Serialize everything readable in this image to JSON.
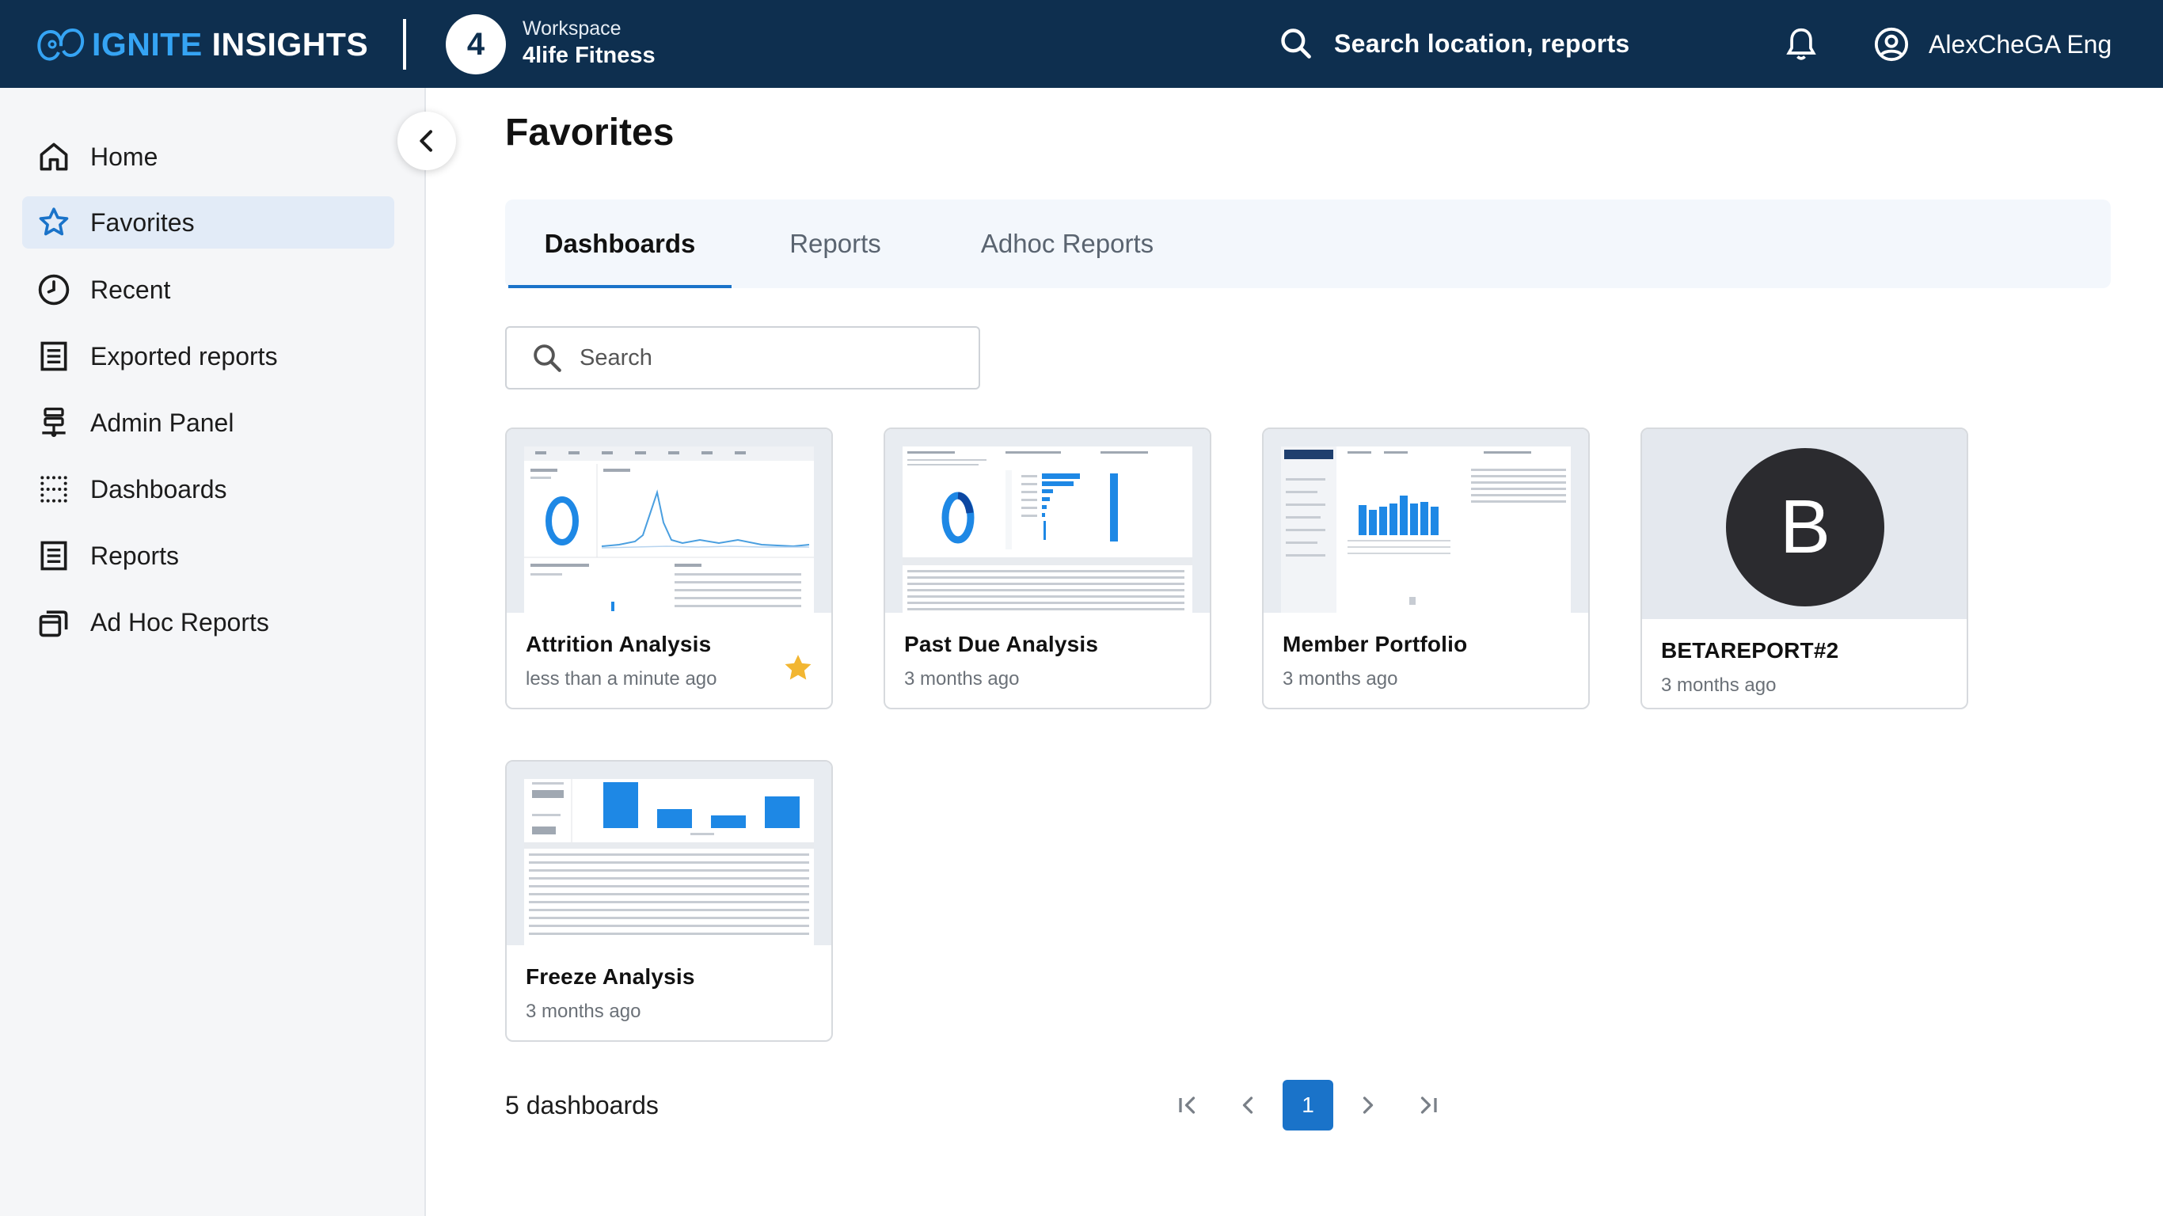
{
  "app": {
    "logo_part1": "IGNITE",
    "logo_part2": "INSIGHTS",
    "workspace_badge": "4",
    "workspace_label": "Workspace",
    "workspace_name": "4life Fitness",
    "search_label": "Search location, reports",
    "user_name": "AlexCheGA Eng",
    "colors": {
      "header_bg": "#0e2f4f",
      "logo_accent": "#35a4f4",
      "primary": "#1a73c9",
      "star": "#f2b632"
    }
  },
  "sidebar": {
    "items": [
      {
        "label": "Home",
        "icon": "home-icon",
        "active": false
      },
      {
        "label": "Favorites",
        "icon": "star-icon",
        "active": true
      },
      {
        "label": "Recent",
        "icon": "clock-icon",
        "active": false
      },
      {
        "label": "Exported reports",
        "icon": "document-list-icon",
        "active": false
      },
      {
        "label": "Admin Panel",
        "icon": "admin-network-icon",
        "active": false
      },
      {
        "label": "Dashboards",
        "icon": "dots-grid-icon",
        "active": false
      },
      {
        "label": "Reports",
        "icon": "document-list-icon",
        "active": false
      },
      {
        "label": "Ad Hoc Reports",
        "icon": "stacked-pages-icon",
        "active": false
      }
    ]
  },
  "main": {
    "title": "Favorites",
    "tabs": [
      {
        "label": "Dashboards",
        "active": true
      },
      {
        "label": "Reports",
        "active": false
      },
      {
        "label": "Adhoc Reports",
        "active": false
      }
    ],
    "search_placeholder": "Search",
    "cards": [
      {
        "title": "Attrition Analysis",
        "time": "less than a minute ago",
        "favorited": true,
        "thumbnail": "dashboard-thumbnail"
      },
      {
        "title": "Past Due Analysis",
        "time": "3 months ago",
        "favorited": false,
        "thumbnail": "dashboard-thumbnail"
      },
      {
        "title": "Member Portfolio",
        "time": "3 months ago",
        "favorited": false,
        "thumbnail": "dashboard-thumbnail"
      },
      {
        "title": "BETAREPORT#2",
        "time": "3 months ago",
        "favorited": false,
        "thumbnail": "avatar",
        "avatar_letter": "B"
      },
      {
        "title": "Freeze Analysis",
        "time": "3 months ago",
        "favorited": false,
        "thumbnail": "dashboard-thumbnail"
      }
    ],
    "count_label": "5 dashboards",
    "pagination": {
      "current_page": "1"
    }
  }
}
